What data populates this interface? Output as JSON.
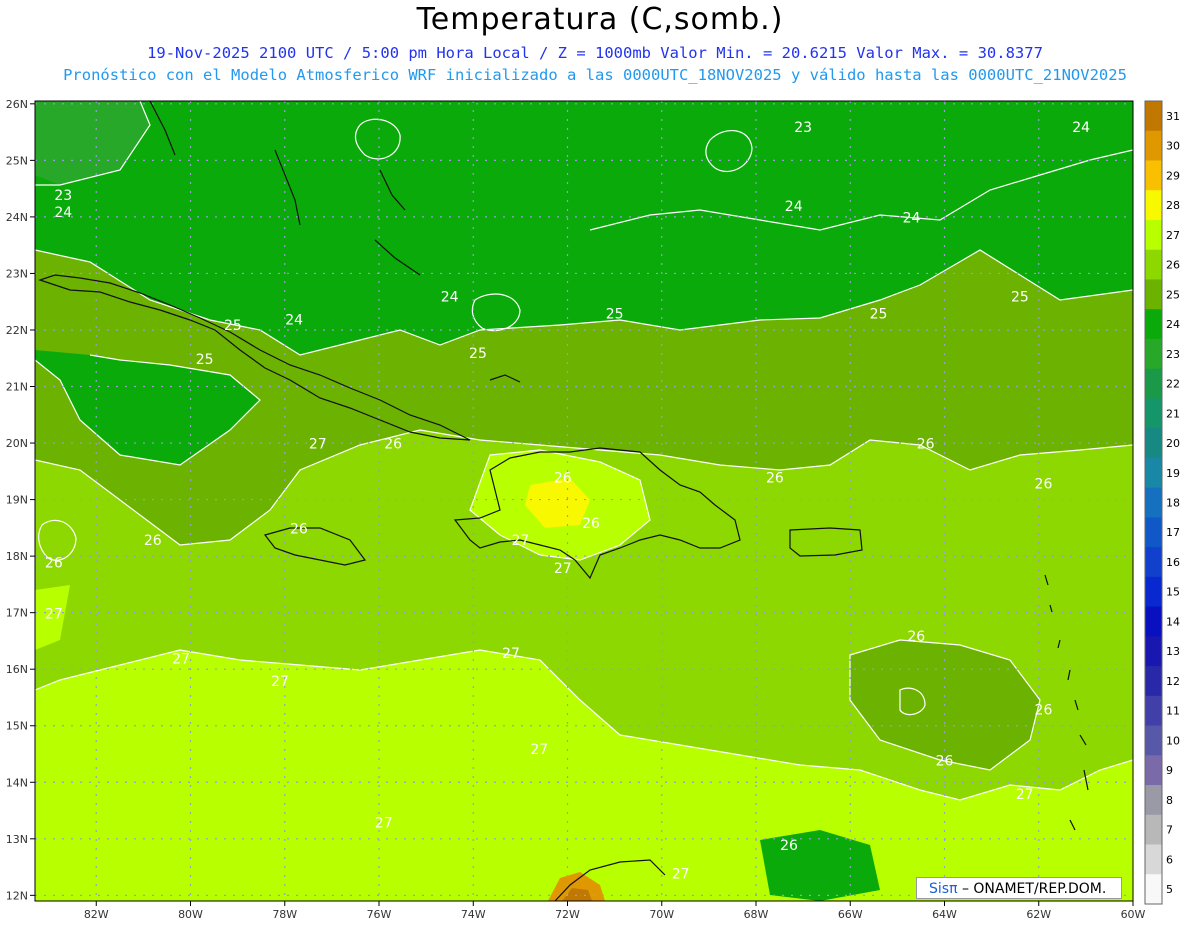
{
  "header": {
    "title": "Temperatura (C,somb.)",
    "subtitle_line1": "19-Nov-2025  2100 UTC / 5:00 pm Hora Local / Z = 1000mb   Valor Min. = 20.6215  Valor Max. = 30.8377",
    "subtitle_line2": "Pronóstico con el Modelo Atmosferico WRF inicializado a las 0000UTC_18NOV2025 y válido hasta las  0000UTC_21NOV2025"
  },
  "map": {
    "lon_range": [
      -83.3,
      -60
    ],
    "lat_range": [
      11.9,
      26.05
    ],
    "lon_ticks": [
      "82W",
      "80W",
      "78W",
      "76W",
      "74W",
      "72W",
      "70W",
      "68W",
      "66W",
      "64W",
      "62W",
      "60W"
    ],
    "lat_ticks": [
      "26N",
      "25N",
      "24N",
      "23N",
      "22N",
      "21N",
      "20N",
      "19N",
      "18N",
      "17N",
      "16N",
      "15N",
      "14N",
      "13N",
      "12N"
    ],
    "contour_labels": [
      {
        "text": "23",
        "lon": -82.7,
        "lat": 24.3
      },
      {
        "text": "24",
        "lon": -82.7,
        "lat": 24.0
      },
      {
        "text": "23",
        "lon": -67.0,
        "lat": 25.5
      },
      {
        "text": "24",
        "lon": -61.1,
        "lat": 25.5
      },
      {
        "text": "24",
        "lon": -67.2,
        "lat": 24.1
      },
      {
        "text": "24",
        "lon": -64.7,
        "lat": 23.9
      },
      {
        "text": "24",
        "lon": -74.5,
        "lat": 22.5
      },
      {
        "text": "24",
        "lon": -77.8,
        "lat": 22.1
      },
      {
        "text": "25",
        "lon": -79.1,
        "lat": 22.0
      },
      {
        "text": "25",
        "lon": -79.7,
        "lat": 21.4
      },
      {
        "text": "25",
        "lon": -73.9,
        "lat": 21.5
      },
      {
        "text": "25",
        "lon": -71.0,
        "lat": 22.2
      },
      {
        "text": "25",
        "lon": -65.4,
        "lat": 22.2
      },
      {
        "text": "25",
        "lon": -62.4,
        "lat": 22.5
      },
      {
        "text": "26",
        "lon": -64.4,
        "lat": 19.9
      },
      {
        "text": "26",
        "lon": -75.7,
        "lat": 19.9
      },
      {
        "text": "26",
        "lon": -72.1,
        "lat": 19.3
      },
      {
        "text": "26",
        "lon": -67.6,
        "lat": 19.3
      },
      {
        "text": "26",
        "lon": -61.9,
        "lat": 19.2
      },
      {
        "text": "26",
        "lon": -77.7,
        "lat": 18.4
      },
      {
        "text": "26",
        "lon": -80.8,
        "lat": 18.2
      },
      {
        "text": "26",
        "lon": -82.9,
        "lat": 17.8
      },
      {
        "text": "26",
        "lon": -71.5,
        "lat": 18.5
      },
      {
        "text": "27",
        "lon": -77.3,
        "lat": 19.9
      },
      {
        "text": "27",
        "lon": -73.0,
        "lat": 18.2
      },
      {
        "text": "27",
        "lon": -72.1,
        "lat": 17.7
      },
      {
        "text": "27",
        "lon": -82.9,
        "lat": 16.9
      },
      {
        "text": "27",
        "lon": -80.2,
        "lat": 16.1
      },
      {
        "text": "27",
        "lon": -78.1,
        "lat": 15.7
      },
      {
        "text": "27",
        "lon": -73.2,
        "lat": 16.2
      },
      {
        "text": "27",
        "lon": -72.6,
        "lat": 14.5
      },
      {
        "text": "27",
        "lon": -75.9,
        "lat": 13.2
      },
      {
        "text": "27",
        "lon": -69.6,
        "lat": 12.3
      },
      {
        "text": "27",
        "lon": -62.3,
        "lat": 13.7
      },
      {
        "text": "26",
        "lon": -64.6,
        "lat": 16.5
      },
      {
        "text": "26",
        "lon": -61.9,
        "lat": 15.2
      },
      {
        "text": "26",
        "lon": -64.0,
        "lat": 14.3
      },
      {
        "text": "26",
        "lon": -67.3,
        "lat": 12.8
      }
    ]
  },
  "colorbar": {
    "labels": [
      "31",
      "30",
      "29",
      "28",
      "27",
      "26",
      "25",
      "24",
      "23",
      "22",
      "21",
      "20",
      "19",
      "18",
      "17",
      "16",
      "15",
      "14",
      "13",
      "12",
      "11",
      "10",
      "9",
      "8",
      "7",
      "6",
      "5"
    ],
    "colors": [
      "#c07800",
      "#e09800",
      "#f8c000",
      "#f8f800",
      "#b8ff00",
      "#8cd800",
      "#6cb200",
      "#0aaa0a",
      "#28a828",
      "#1a9a48",
      "#14966a",
      "#168a82",
      "#1888a6",
      "#1670c0",
      "#1058c8",
      "#1040cc",
      "#0a28d0",
      "#0810c0",
      "#1818b0",
      "#2828a8",
      "#4040a8",
      "#5858a8",
      "#7a6aaa",
      "#9a9aa6",
      "#b8b8b8",
      "#d8d8d8",
      "#f8f8f8"
    ]
  },
  "watermark": {
    "brand": "Sisπ",
    "rest": " – ONAMET/REP.DOM."
  }
}
